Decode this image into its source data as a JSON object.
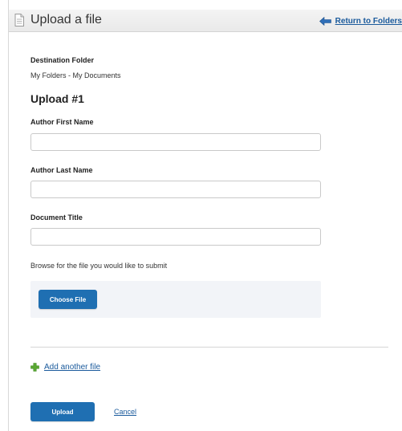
{
  "header": {
    "title": "Upload a file",
    "return_label": "Return to Folders"
  },
  "destination": {
    "label": "Destination Folder",
    "value": "My Folders - My Documents"
  },
  "upload_section": {
    "heading": "Upload #1"
  },
  "fields": {
    "author_first_name": {
      "label": "Author First Name",
      "value": ""
    },
    "author_last_name": {
      "label": "Author Last Name",
      "value": ""
    },
    "document_title": {
      "label": "Document Title",
      "value": ""
    }
  },
  "file_browse": {
    "prompt": "Browse for the file you would like to submit",
    "button_label": "Choose File"
  },
  "add_another": {
    "label": "Add another file"
  },
  "actions": {
    "upload_label": "Upload",
    "cancel_label": "Cancel"
  },
  "colors": {
    "primary_button": "#1f6fb2",
    "link": "#1a5a9c",
    "add_icon": "#5aa832",
    "return_arrow": "#2f6fb8",
    "panel_background": "#f2f4f8"
  },
  "icons": {
    "header": "document-icon",
    "return": "arrow-left-icon",
    "add": "plus-icon"
  }
}
